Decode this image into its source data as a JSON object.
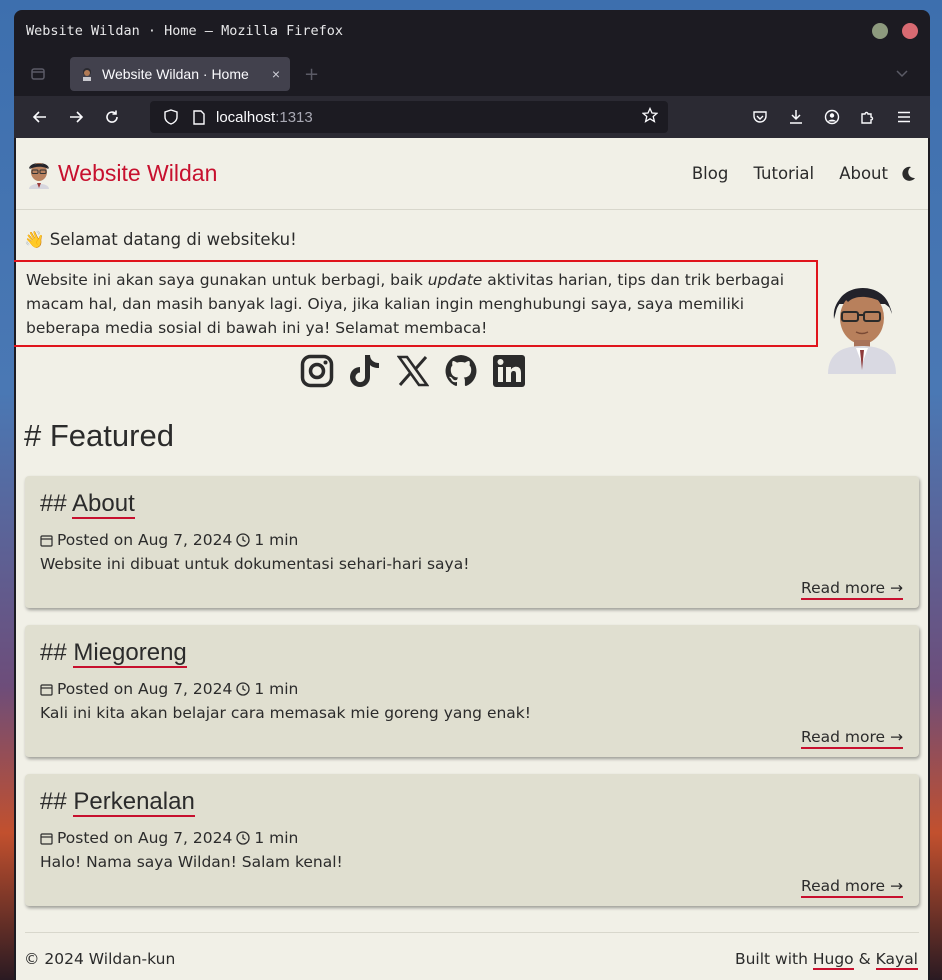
{
  "window": {
    "title": "Website Wildan · Home — Mozilla Firefox"
  },
  "browser": {
    "tab_title": "Website Wildan · Home",
    "tab_close": "×",
    "new_tab": "+",
    "url_host": "localhost",
    "url_port": ":1313"
  },
  "site": {
    "title": "Website Wildan",
    "menu": [
      "Blog",
      "Tutorial",
      "About"
    ],
    "welcome": "👋 Selamat datang di websiteku!",
    "intro_before": "Website ini akan saya gunakan untuk berbagi, baik ",
    "intro_em": "update",
    "intro_after": " aktivitas harian, tips dan trik berbagai macam hal, dan masih banyak lagi. Oiya, jika kalian ingin menghubungi saya, saya memiliki beberapa media sosial di bawah ini ya! Selamat membaca!",
    "socials": [
      "instagram-icon",
      "tiktok-icon",
      "x-icon",
      "github-icon",
      "linkedin-icon"
    ],
    "featured_heading": "# Featured",
    "posts": [
      {
        "prefix": "## ",
        "title": "About",
        "posted": "Posted on Aug 7, 2024",
        "read": "1 min",
        "desc": "Website ini dibuat untuk dokumentasi sehari-hari saya!",
        "more": "Read more →"
      },
      {
        "prefix": "## ",
        "title": "Miegoreng",
        "posted": "Posted on Aug 7, 2024",
        "read": "1 min",
        "desc": "Kali ini kita akan belajar cara memasak mie goreng yang enak!",
        "more": "Read more →"
      },
      {
        "prefix": "## ",
        "title": "Perkenalan",
        "posted": "Posted on Aug 7, 2024",
        "read": "1 min",
        "desc": "Halo! Nama saya Wildan! Salam kenal!",
        "more": "Read more →"
      }
    ],
    "footer_copy": "© 2024 Wildan-kun",
    "footer_built": "Built with ",
    "footer_hugo": "Hugo",
    "footer_amp": " & ",
    "footer_kayal": "Kayal"
  },
  "colors": {
    "accent": "#c7102e",
    "page_bg": "#f1f0e7",
    "card_bg": "#e0dfd0",
    "highlight": "#e0141c"
  }
}
